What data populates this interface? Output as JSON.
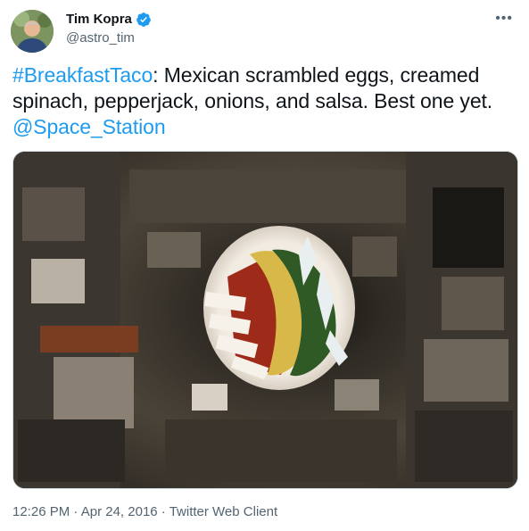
{
  "tweet": {
    "author": {
      "display_name": "Tim Kopra",
      "handle": "@astro_tim",
      "verified_icon": "verified-badge-icon",
      "accent": "#1d9bf0"
    },
    "text": {
      "hashtag": "#BreakfastTaco",
      "body": ": Mexican scrambled eggs, creamed spinach, pepperjack, onions, and salsa. Best one yet.",
      "mention": "@Space_Station"
    },
    "media": {
      "description_icon": "photo-breakfast-taco-floating-in-iss"
    },
    "meta": {
      "time": "12:26 PM",
      "separator": " · ",
      "date": "Apr 24, 2016",
      "client": "Twitter Web Client"
    },
    "more_icon": "more-options-icon"
  }
}
